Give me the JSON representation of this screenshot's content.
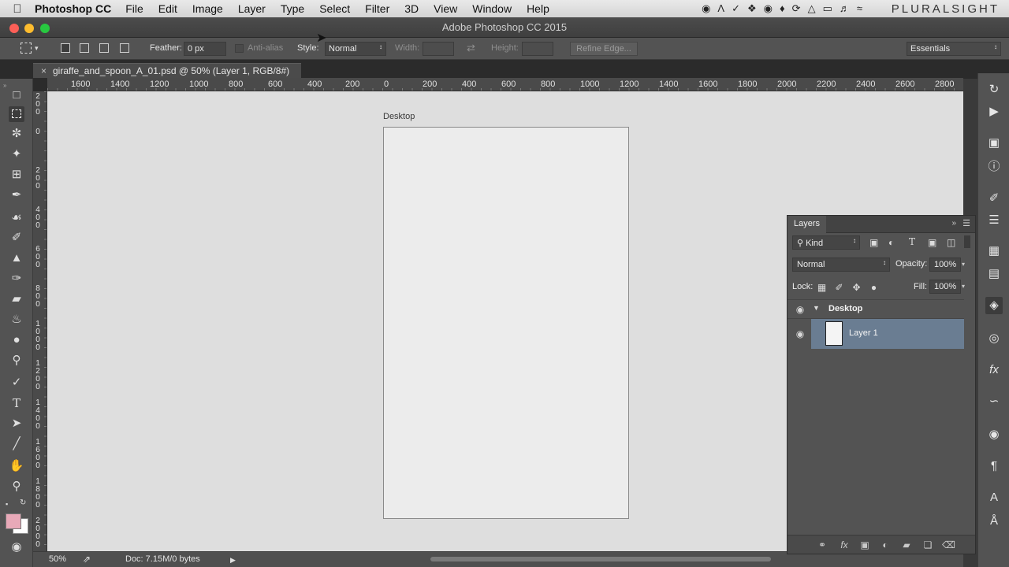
{
  "menubar": {
    "app_name": "Photoshop CC",
    "menus": [
      "File",
      "Edit",
      "Image",
      "Layer",
      "Type",
      "Select",
      "Filter",
      "3D",
      "View",
      "Window",
      "Help"
    ],
    "status_icons": [
      "record-icon",
      "adobe-icon",
      "check-icon",
      "dropbox-icon",
      "eye-icon",
      "evernote-icon",
      "sync-icon",
      "drive-icon",
      "battery-icon",
      "volume-icon",
      "wifi-icon"
    ],
    "brand": "PLURALSIGHT"
  },
  "window": {
    "title": "Adobe Photoshop CC 2015"
  },
  "options_bar": {
    "feather_label": "Feather:",
    "feather_value": "0 px",
    "antialias_label": "Anti-alias",
    "style_label": "Style:",
    "style_value": "Normal",
    "width_label": "Width:",
    "height_label": "Height:",
    "refine_edge_label": "Refine Edge...",
    "workspace": "Essentials"
  },
  "document": {
    "tab_title": "giraffe_and_spoon_A_01.psd @ 50% (Layer 1, RGB/8#)",
    "artboard_name": "Desktop"
  },
  "ruler": {
    "horizontal": [
      "1600",
      "1400",
      "1200",
      "1000",
      "800",
      "600",
      "400",
      "200",
      "0",
      "200",
      "400",
      "600",
      "800",
      "1000",
      "1200",
      "1400",
      "1600",
      "1800",
      "2000",
      "2200",
      "2400",
      "2600",
      "2800"
    ],
    "vertical": [
      "200",
      "0",
      "200",
      "400",
      "600",
      "800",
      "1000",
      "1200",
      "1400",
      "1600",
      "1800",
      "2000"
    ]
  },
  "status_bar": {
    "zoom": "50%",
    "doc_info": "Doc: 7.15M/0 bytes"
  },
  "layers_panel": {
    "tab": "Layers",
    "filter_kind": "Kind",
    "blend_mode": "Normal",
    "opacity_label": "Opacity:",
    "opacity_value": "100%",
    "lock_label": "Lock:",
    "fill_label": "Fill:",
    "fill_value": "100%",
    "group_name": "Desktop",
    "layer_name": "Layer 1"
  },
  "colors": {
    "foreground": "#e8a9b8",
    "background": "#ffffff",
    "selected_layer": "#6a7d92"
  }
}
